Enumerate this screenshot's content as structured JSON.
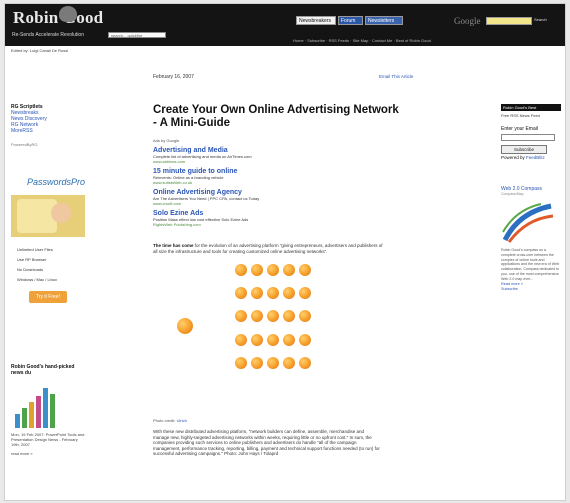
{
  "header": {
    "logo_text": "Robin Good",
    "tagline": "Re-Sends Accelerate Revolution",
    "search_placeholder": "search... quickfire",
    "button_1": "Newsbreakers",
    "button_2": "Forum",
    "button_3": "Newsletters",
    "google_logo": "Google",
    "google_button": "Search",
    "nav_links": "Home · Subscribe · RSS Feeds · Site Map · Contact Me · Best of Robin Good",
    "sub_line_1": "Edited by: Luigi Canali De Rossi",
    "sub_line_2": ""
  },
  "left": {
    "heading": "RG Scriptlets",
    "links": [
      "Newsbreaks",
      "News Discovery",
      "RG Network",
      "MoreRSS"
    ],
    "small_note": "PoweredByRG",
    "ad": {
      "title": "PasswordsPro",
      "list": [
        "Unlimited User Files",
        "Use RP Browser",
        "No Downloads",
        "Windows / Mac / Linux"
      ],
      "button": "Try it Free!"
    },
    "rg_box": {
      "title": "Robin Good's hand-picked news du",
      "text": "Mon, 19 Feb 2007: PowerPoint Tools and Presentation Design News - February 19th, 2007",
      "more": "read more »"
    }
  },
  "main": {
    "date": "February 16, 2007",
    "email_link": "Email This Article",
    "title": "Create Your Own Online Advertising Network - A Mini-Guide",
    "ads_by": "Ads by Google",
    "ads": [
      {
        "title": "Advertising and Media",
        "desc": "Complete list of advertising and media on AirTimes.com",
        "url": "www.airtimes.com"
      },
      {
        "title": "15 minute guide to online",
        "desc": "Reinvents: Online as a branding vehicle",
        "url": "www.suitsbelleb.co.uk"
      },
      {
        "title": "Online Advertising Agency",
        "desc": "Are The Advertisers You Need | PPC CPA, contact us Today",
        "url": "www.crsoft.com"
      },
      {
        "title": "Solo Ezine Ads",
        "desc": "Position Mass effect low cost effective Solo Ezine Ads",
        "url": "RightsWeb Publishing.com"
      }
    ],
    "intro_lead": "The time has come",
    "intro_rest": " for the evolution of an advertising platform \"giving entrepreneurs, advertisers and publishers of all size the infrastructure and tools for creating customized online advertising networks\".",
    "photo_credit_label": "Photo credit:",
    "photo_credit_link": "Ulrich",
    "para2": "With these new distributed advertising platform, \"network builders can define, assemble, merchandise and manage new, highly-targeted advertising networks within weeks, requiring little or no upfront cost.\" In sum, the companies providing such services to online publishers and advertisers do handle \"all of the campaign management, performance tracking, reporting, billing, payment and technical support functions needed (to run) for successful advertising campaigns.\" Photo: John Hays / Tolaprd"
  },
  "right": {
    "header": "Robin Good's Best",
    "sub": "Free RSS News Feed",
    "email_label": "Enter your Email",
    "subscribe_button": "Subscribe",
    "powered_label": "Powered by",
    "powered_link": "FeedBlitz",
    "web20": {
      "title": "Web 2.0 Compass",
      "sub": "Compass/Map",
      "text": "Robin Good's compass on a complete cross-over between the complex of online tools and applications and the new era of Web collaboration. Compass dedicated to you, one of the most comprehensive Web 2.0 map ever...",
      "links": [
        "Read more »",
        "Subscribe"
      ]
    }
  },
  "colors": {
    "header_bg": "#141414",
    "link_blue": "#2a55b5",
    "orange": "#f59d2a",
    "ad_gold": "#e7cf7a"
  }
}
